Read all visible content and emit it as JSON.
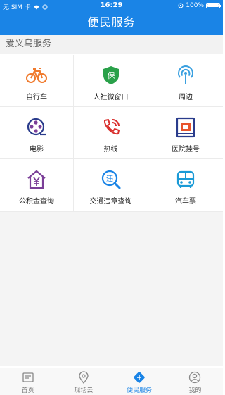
{
  "status": {
    "carrier": "无 SIM 卡",
    "time": "16:29",
    "battery": "100%"
  },
  "nav": {
    "title": "便民服务"
  },
  "section": {
    "title": "爱义乌服务"
  },
  "services": [
    {
      "label": "自行车",
      "icon": "bicycle-icon",
      "color": "#f07a2d"
    },
    {
      "label": "人社微窗口",
      "icon": "shield-bao-icon",
      "color": "#2aa14a"
    },
    {
      "label": "周边",
      "icon": "signal-pin-icon",
      "color": "#3aa0e0"
    },
    {
      "label": "电影",
      "icon": "film-reel-icon",
      "color": "#2a3c8c"
    },
    {
      "label": "热线",
      "icon": "phone-icon",
      "color": "#d9302e"
    },
    {
      "label": "医院挂号",
      "icon": "hospital-icon",
      "color": "#2a3c8c"
    },
    {
      "label": "公积金查询",
      "icon": "house-yen-icon",
      "color": "#7b3f98"
    },
    {
      "label": "交通违章查询",
      "icon": "violation-search-icon",
      "color": "#1a84e6"
    },
    {
      "label": "汽车票",
      "icon": "bus-icon",
      "color": "#1a9ad6"
    }
  ],
  "tabs": [
    {
      "label": "首页",
      "icon": "home-icon"
    },
    {
      "label": "现场云",
      "icon": "location-icon"
    },
    {
      "label": "便民服务",
      "icon": "services-icon",
      "active": true
    },
    {
      "label": "我的",
      "icon": "profile-icon"
    }
  ],
  "colors": {
    "primary": "#1a84e6",
    "active_tab": "#1a84e6"
  }
}
